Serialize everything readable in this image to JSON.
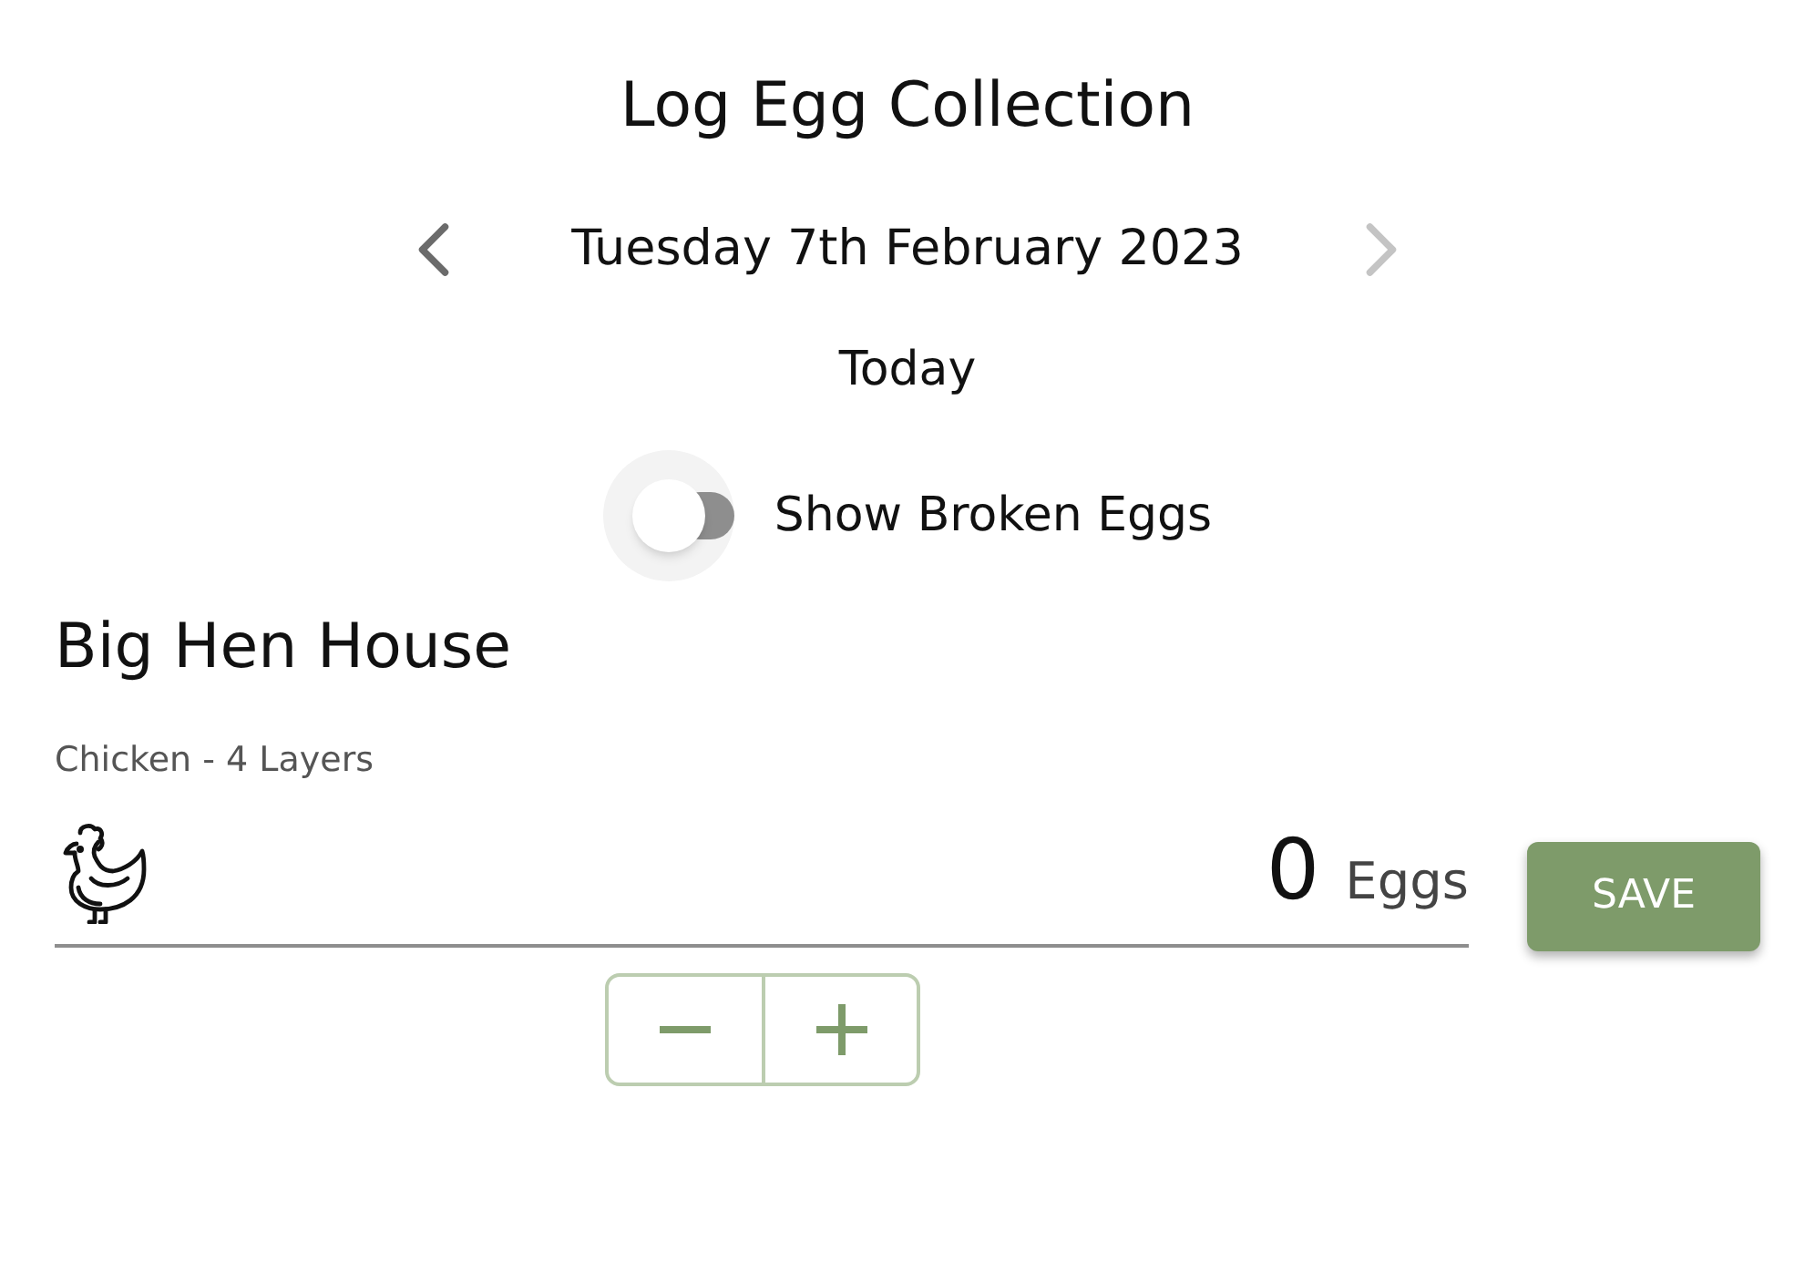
{
  "title": "Log Egg Collection",
  "date_nav": {
    "date": "Tuesday 7th February 2023",
    "prev_disabled": false,
    "next_disabled": true
  },
  "day_label": "Today",
  "broken_toggle": {
    "label": "Show Broken Eggs",
    "on": false
  },
  "houses": [
    {
      "name": "Big Hen House",
      "subtitle": "Chicken - 4 Layers",
      "count": "0",
      "unit": "Eggs",
      "save": "SAVE"
    }
  ]
}
